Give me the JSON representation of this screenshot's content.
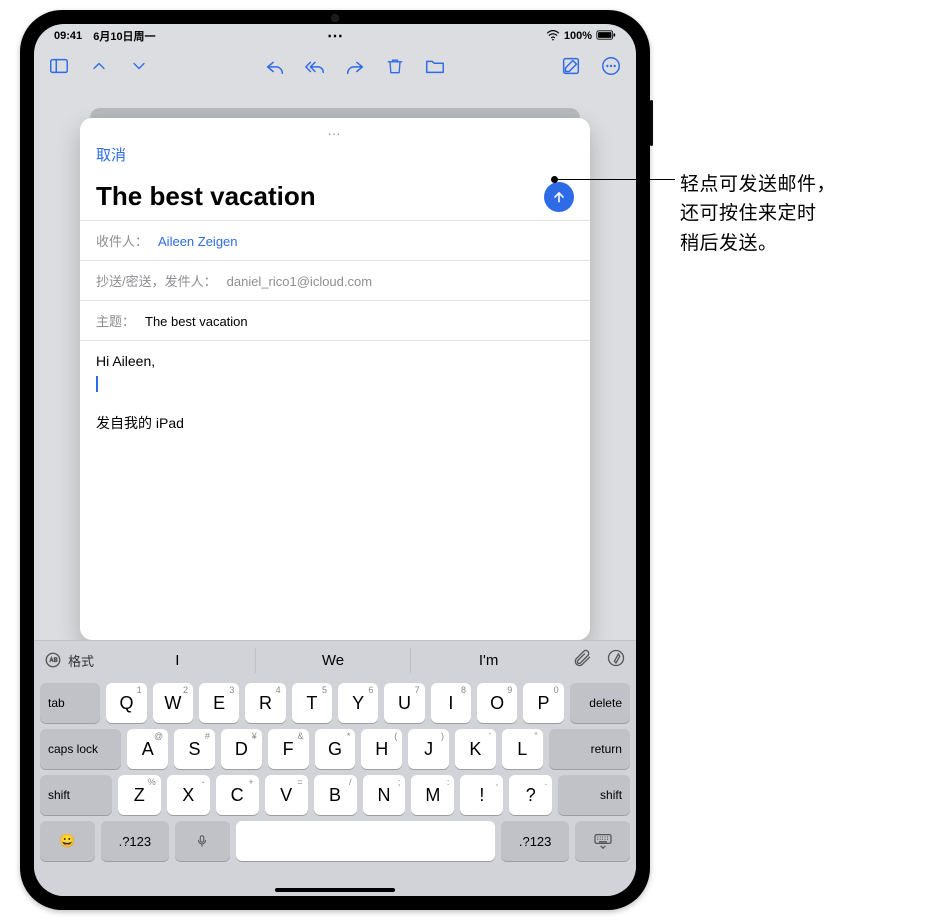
{
  "status": {
    "time": "09:41",
    "date": "6月10日周一",
    "battery": "100%"
  },
  "toolbar_icons": {
    "sidebar": "sidebar-icon",
    "up": "chevron-up-icon",
    "down": "chevron-down-icon",
    "reply": "reply-icon",
    "replyall": "reply-all-icon",
    "forward": "forward-icon",
    "trash": "trash-icon",
    "folder": "folder-icon",
    "compose": "compose-icon",
    "more": "more-icon"
  },
  "compose": {
    "pill": "…",
    "cancel": "取消",
    "title": "The best vacation",
    "to_label": "收件人：",
    "to_value": "Aileen Zeigen",
    "cc_label": "抄送/密送，发件人：",
    "cc_value": "daniel_rico1@icloud.com",
    "subject_label": "主题：",
    "subject_value": "The best vacation",
    "body_greeting": "Hi Aileen,",
    "signature": "发自我的 iPad"
  },
  "keyboard": {
    "format_label": "格式",
    "suggestions": [
      "I",
      "We",
      "I'm"
    ],
    "row1": [
      {
        "k": "Q",
        "s": "1"
      },
      {
        "k": "W",
        "s": "2"
      },
      {
        "k": "E",
        "s": "3"
      },
      {
        "k": "R",
        "s": "4"
      },
      {
        "k": "T",
        "s": "5"
      },
      {
        "k": "Y",
        "s": "6"
      },
      {
        "k": "U",
        "s": "7"
      },
      {
        "k": "I",
        "s": "8"
      },
      {
        "k": "O",
        "s": "9"
      },
      {
        "k": "P",
        "s": "0"
      }
    ],
    "row2": [
      {
        "k": "A",
        "s": "@"
      },
      {
        "k": "S",
        "s": "#"
      },
      {
        "k": "D",
        "s": "¥"
      },
      {
        "k": "F",
        "s": "&"
      },
      {
        "k": "G",
        "s": "*"
      },
      {
        "k": "H",
        "s": "("
      },
      {
        "k": "J",
        "s": ")"
      },
      {
        "k": "K",
        "s": "'"
      },
      {
        "k": "L",
        "s": "\""
      }
    ],
    "row3": [
      {
        "k": "Z",
        "s": "%"
      },
      {
        "k": "X",
        "s": "-"
      },
      {
        "k": "C",
        "s": "+"
      },
      {
        "k": "V",
        "s": "="
      },
      {
        "k": "B",
        "s": "/"
      },
      {
        "k": "N",
        "s": ";"
      },
      {
        "k": "M",
        "s": ":"
      }
    ],
    "punct1": {
      "k": "!",
      "s": ","
    },
    "punct2": {
      "k": "?",
      "s": "."
    },
    "tab": "tab",
    "delete": "delete",
    "caps": "caps lock",
    "return": "return",
    "shift": "shift",
    "symbols": ".?123"
  },
  "callout": {
    "line1": "轻点可发送邮件，",
    "line2": "还可按住来定时",
    "line3": "稍后发送。"
  },
  "colors": {
    "accent": "#2e6be6"
  }
}
